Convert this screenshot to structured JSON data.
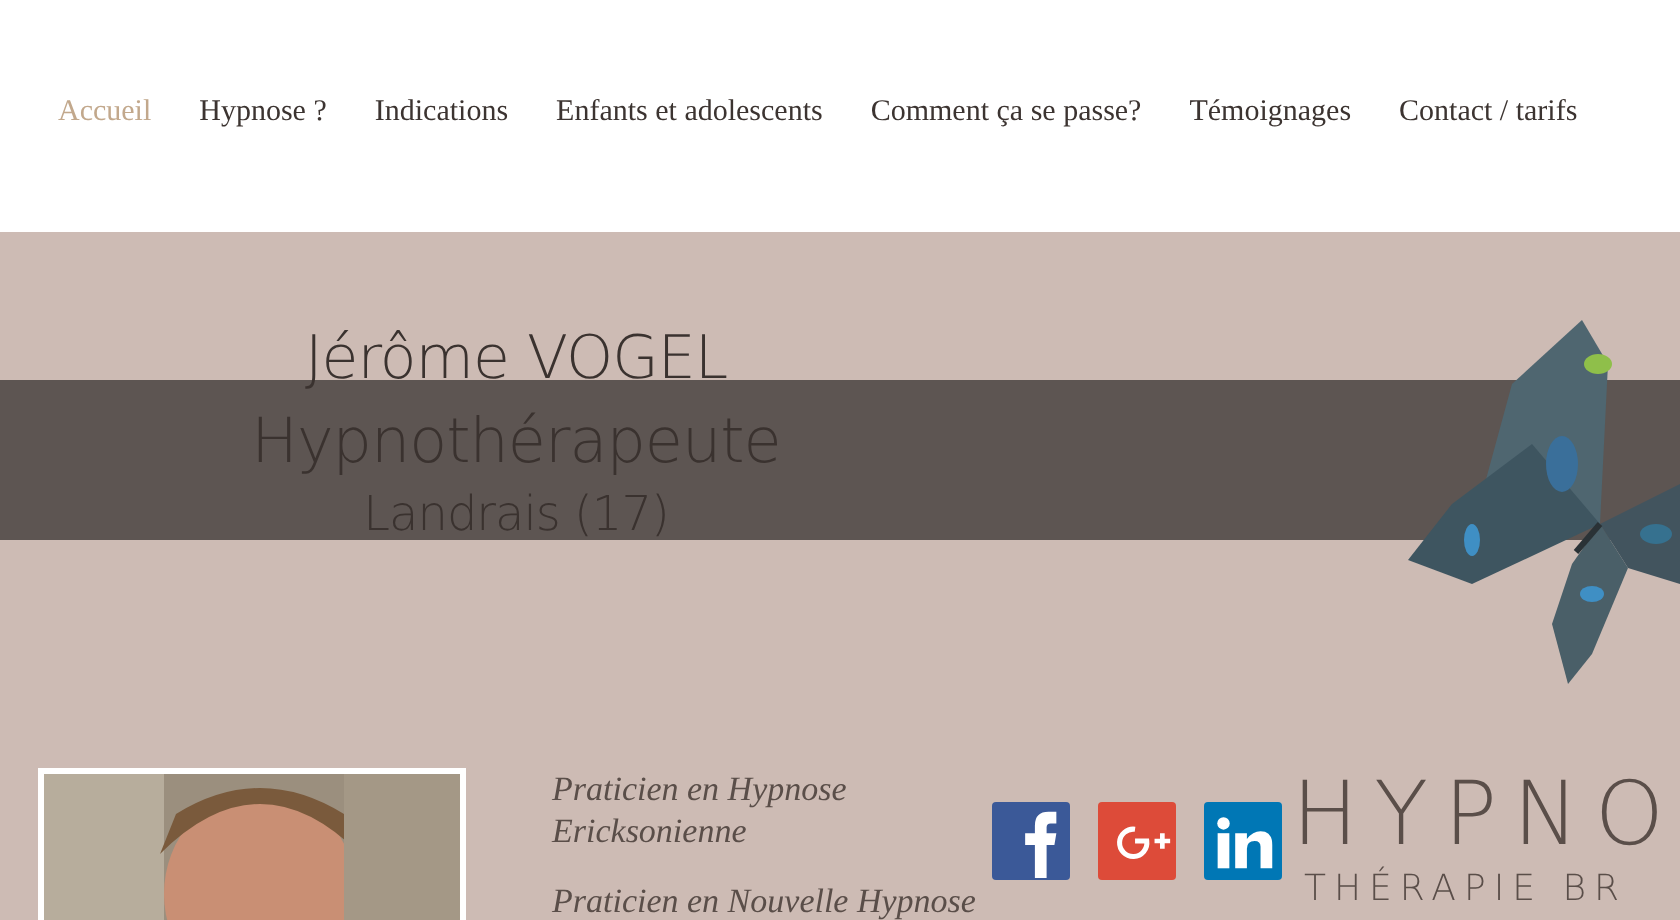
{
  "nav": {
    "items": [
      {
        "label": "Accueil",
        "selected": true
      },
      {
        "label": "Hypnose ?",
        "selected": false
      },
      {
        "label": "Indications",
        "selected": false
      },
      {
        "label": "Enfants et adolescents",
        "selected": false
      },
      {
        "label": "Comment ça se passe?",
        "selected": false
      },
      {
        "label": "Témoignages",
        "selected": false
      },
      {
        "label": "Contact / tarifs",
        "selected": false
      }
    ]
  },
  "hero": {
    "name": "Jérôme VOGEL",
    "title": "Hypnothérapeute",
    "location": "Landrais (17)"
  },
  "intro": {
    "lines": [
      "Praticien en Hypnose",
      "Ericksonienne",
      "Praticien en Nouvelle Hypnose"
    ]
  },
  "social": [
    {
      "kind": "facebook"
    },
    {
      "kind": "google-plus"
    },
    {
      "kind": "linkedin"
    }
  ],
  "logo": {
    "main": "HYPNO",
    "sub": "THÉRAPIE BR"
  }
}
